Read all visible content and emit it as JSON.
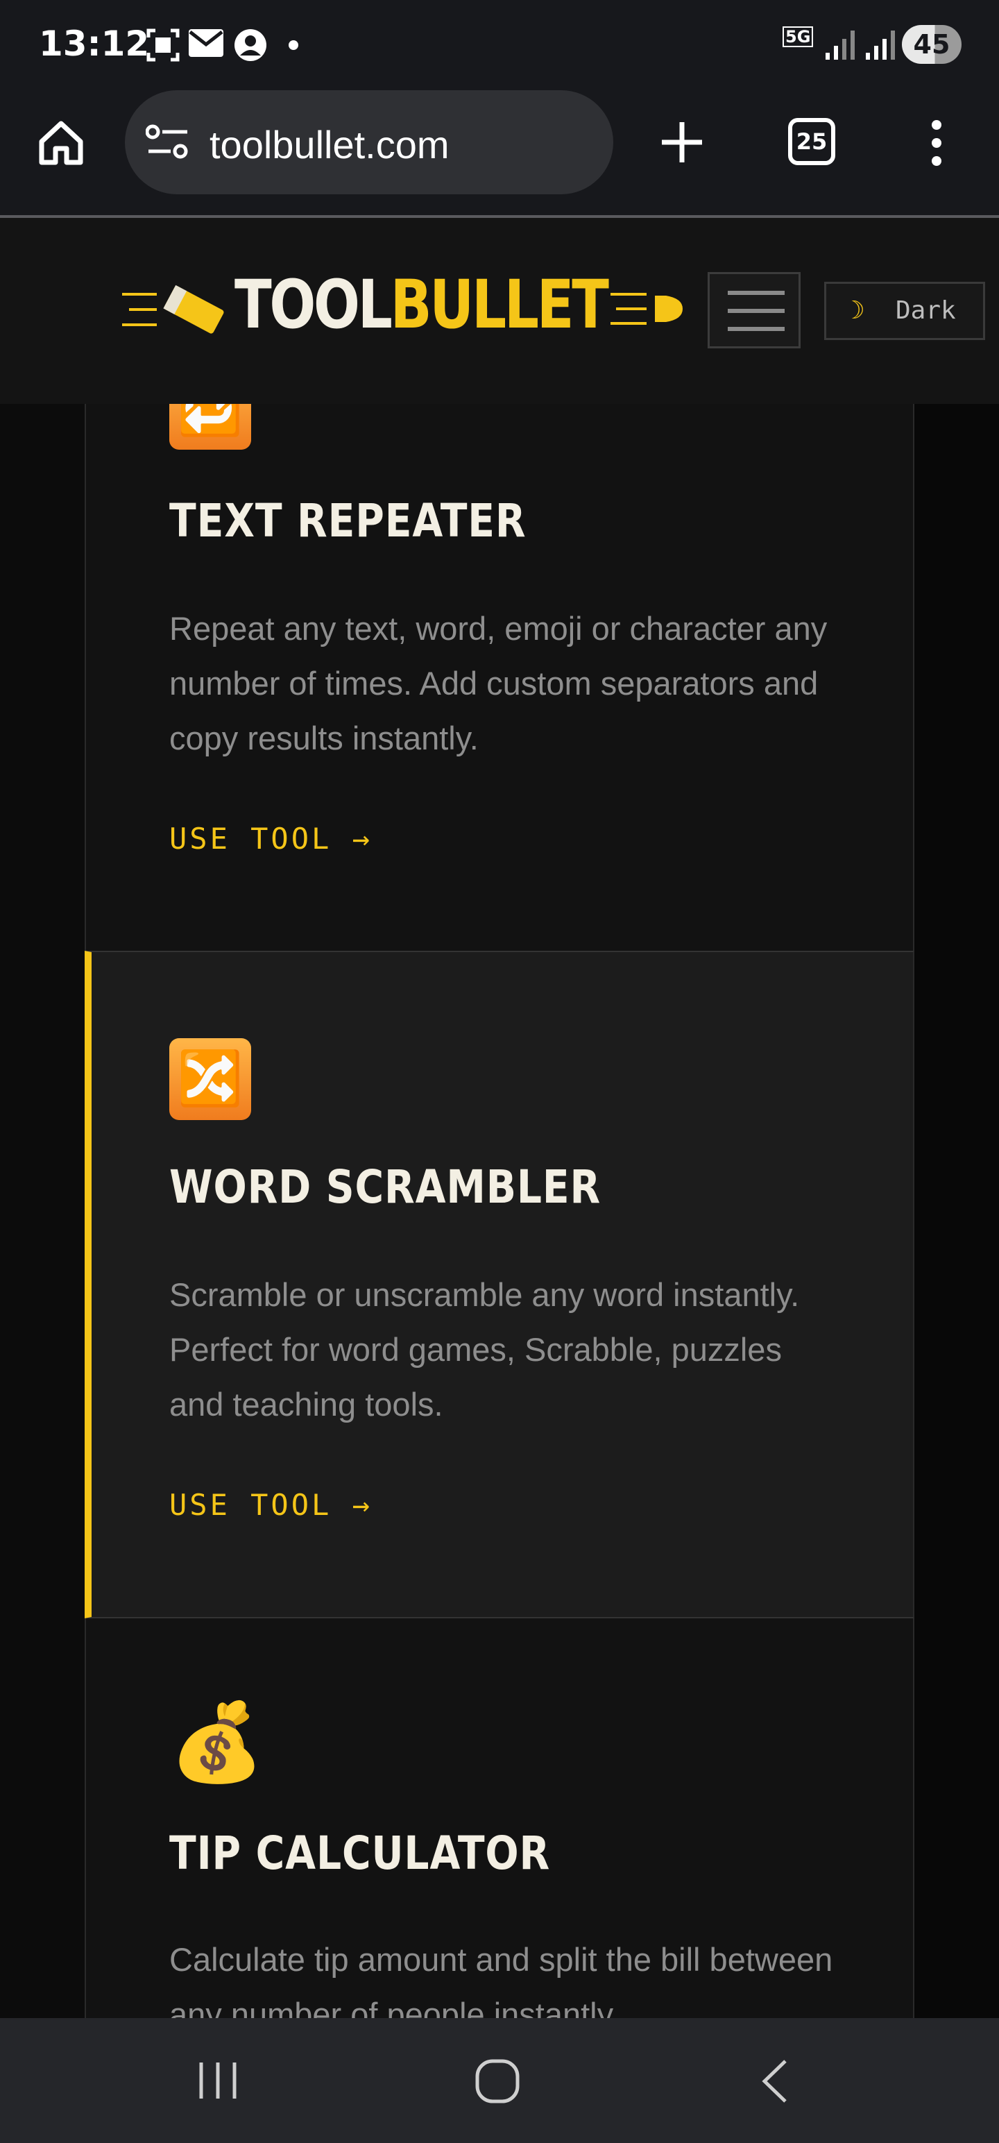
{
  "status_bar": {
    "time": "13:12",
    "network": "5G",
    "battery": "45"
  },
  "browser": {
    "url": "toolbullet.com",
    "tab_count": "25"
  },
  "site_header": {
    "logo_part1": "TOOL",
    "logo_part2": "BULLET",
    "theme_icon": "☽",
    "theme_label": "Dark"
  },
  "cards": [
    {
      "icon": "🔁",
      "title": "TEXT REPEATER",
      "description": "Repeat any text, word, emoji or character any number of times. Add custom separators and copy results instantly.",
      "link": "USE TOOL →"
    },
    {
      "icon": "🔀",
      "title": "WORD SCRAMBLER",
      "description": "Scramble or unscramble any word instantly. Perfect for word games, Scrabble, puzzles and teaching tools.",
      "link": "USE TOOL →"
    },
    {
      "icon": "💰",
      "title": "TIP CALCULATOR",
      "description": "Calculate tip amount and split the bill between any number of people instantly."
    }
  ],
  "colors": {
    "accent": "#f5c518",
    "background": "#0a0a0a",
    "card_active": "#1c1c1c"
  }
}
